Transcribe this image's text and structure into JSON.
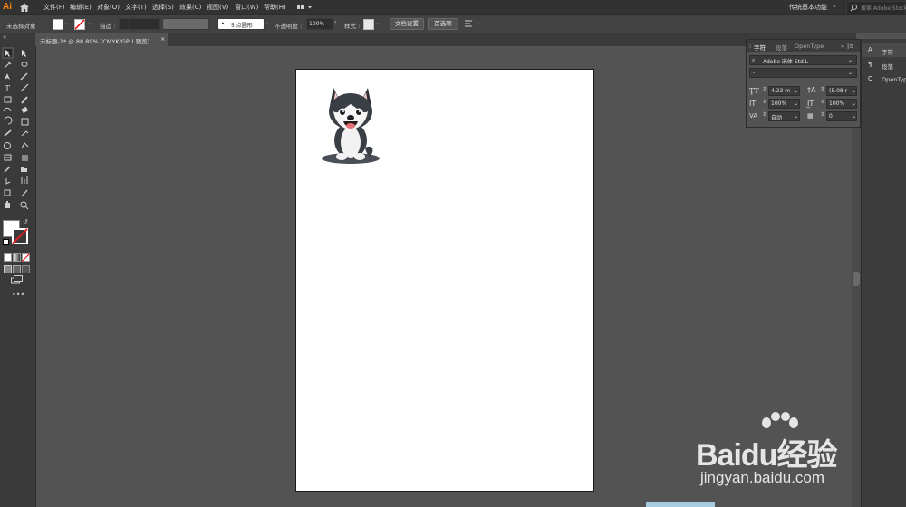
{
  "app": {
    "logo": "Ai"
  },
  "menu": [
    "文件(F)",
    "编辑(E)",
    "对象(O)",
    "文字(T)",
    "选择(S)",
    "效果(C)",
    "视图(V)",
    "窗口(W)",
    "帮助(H)"
  ],
  "workspace": {
    "label": "传统基本功能"
  },
  "search": {
    "placeholder": "搜索 Adobe Stock"
  },
  "control": {
    "selection_status": "未选择对象",
    "stroke_label": "描边 :",
    "brush_label": "5 点圆形",
    "opacity_label": "不透明度 :",
    "opacity_value": "100%",
    "style_label": "样式 :",
    "doc_setup_button": "文档设置",
    "preferences_button": "首选项"
  },
  "document_tab": {
    "title": "未标题-1* @ 88.89% (CMYK/GPU 预览)",
    "close": "×"
  },
  "character_panel": {
    "tabs": [
      "字符",
      "段落",
      "OpenType"
    ],
    "font_family": "Adobe 宋体 Std L",
    "font_style": "-",
    "font_size": "4.23 m",
    "leading": "(5.08 r",
    "vertical_scale": "100%",
    "horizontal_scale": "100%",
    "kerning": "自动",
    "tracking": "0"
  },
  "right_panel_items": [
    {
      "icon": "A",
      "label": "字符"
    },
    {
      "icon": "¶",
      "label": "段落"
    },
    {
      "icon": "O",
      "label": "OpenType"
    }
  ],
  "watermark": {
    "main": "Baidu经验",
    "sub": "jingyan.baidu.com"
  },
  "colors": {
    "accent": "#ff8a00",
    "canvas": "#535353",
    "artboard": "#ffffff"
  }
}
